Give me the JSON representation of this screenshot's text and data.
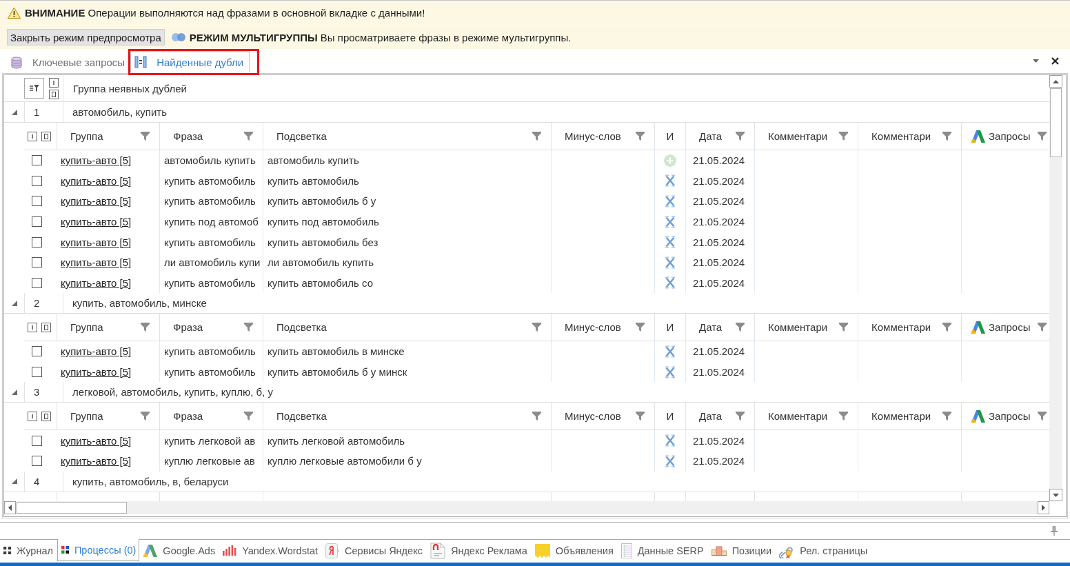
{
  "notice": "**ВНИМАНИЕ** Операции выполняются над фразами в основной вкладке с данными!",
  "preview_bar": {
    "close_button": "Закрыть режим предпросмотра",
    "message": "**РЕЖИМ МУЛЬТИГРУППЫ** Вы просматриваете фразы в режиме мультигруппы."
  },
  "tabs": [
    {
      "label": "Ключевые запросы",
      "selected": false,
      "highlighted": false
    },
    {
      "label": "Найденные дубли",
      "selected": true,
      "highlighted": true
    }
  ],
  "table": {
    "header": "Группа неявных дублей",
    "groups": [
      {
        "number": "1",
        "title": "автомобиль, купить",
        "expanded": true,
        "columns": [
          {
            "label": "Группа",
            "kind": "text",
            "filter": true
          },
          {
            "label": "Фраза",
            "kind": "text",
            "filter": true
          },
          {
            "label": "Подсветка",
            "kind": "text",
            "filter": true
          },
          {
            "label": "Минус-слов",
            "kind": "text",
            "filter": true
          },
          {
            "label": "И",
            "kind": "text",
            "filter": false
          },
          {
            "label": "Дата",
            "kind": "text",
            "filter": true
          },
          {
            "label": "Комментари",
            "kind": "text",
            "filter": true
          },
          {
            "label": "Комментари",
            "kind": "text",
            "filter": true
          },
          {
            "label": "Запросы",
            "kind": "source",
            "filter": true
          }
        ],
        "rows": [
          {
            "checked": false,
            "group": "купить-авто [5]",
            "phrase": "автомобиль купить",
            "highlight": "автомобиль купить",
            "kind": "plus",
            "date": "21.05.2024"
          },
          {
            "checked": false,
            "group": "купить-авто [5]",
            "phrase": "купить автомобиль",
            "highlight": "купить автомобиль",
            "kind": "cross",
            "date": "21.05.2024"
          },
          {
            "checked": false,
            "group": "купить-авто [5]",
            "phrase": "купить автомобиль",
            "highlight": "купить автомобиль б у",
            "kind": "cross",
            "date": "21.05.2024"
          },
          {
            "checked": false,
            "group": "купить-авто [5]",
            "phrase": "купить под автомоб",
            "highlight": "купить под автомобиль",
            "kind": "cross",
            "date": "21.05.2024"
          },
          {
            "checked": false,
            "group": "купить-авто [5]",
            "phrase": "купить автомобиль",
            "highlight": "купить автомобиль без",
            "kind": "cross",
            "date": "21.05.2024"
          },
          {
            "checked": false,
            "group": "купить-авто [5]",
            "phrase": "ли автомобиль купи",
            "highlight": "ли автомобиль купить",
            "kind": "cross",
            "date": "21.05.2024"
          },
          {
            "checked": false,
            "group": "купить-авто [5]",
            "phrase": "купить автомобиль",
            "highlight": "купить автомобиль со",
            "kind": "cross",
            "date": "21.05.2024"
          }
        ]
      },
      {
        "number": "2",
        "title": "купить, автомобиль, минске",
        "expanded": true,
        "columns": [
          {
            "label": "Группа",
            "kind": "text",
            "filter": true
          },
          {
            "label": "Фраза",
            "kind": "text",
            "filter": true
          },
          {
            "label": "Подсветка",
            "kind": "text",
            "filter": true
          },
          {
            "label": "Минус-слов",
            "kind": "text",
            "filter": true
          },
          {
            "label": "И",
            "kind": "text",
            "filter": false
          },
          {
            "label": "Дата",
            "kind": "text",
            "filter": true
          },
          {
            "label": "Комментари",
            "kind": "text",
            "filter": true
          },
          {
            "label": "Комментари",
            "kind": "text",
            "filter": true
          },
          {
            "label": "Запросы",
            "kind": "source",
            "filter": true
          }
        ],
        "rows": [
          {
            "checked": false,
            "group": "купить-авто [5]",
            "phrase": "купить автомобиль",
            "highlight": "купить автомобиль в минске",
            "kind": "cross",
            "date": "21.05.2024"
          },
          {
            "checked": false,
            "group": "купить-авто [5]",
            "phrase": "купить автомобиль",
            "highlight": "купить автомобиль б у минск",
            "kind": "cross",
            "date": "21.05.2024"
          }
        ]
      },
      {
        "number": "3",
        "title": "легковой, автомобиль, купить, куплю, б, у",
        "expanded": true,
        "columns": [
          {
            "label": "Группа",
            "kind": "text",
            "filter": true
          },
          {
            "label": "Фраза",
            "kind": "text",
            "filter": true
          },
          {
            "label": "Подсветка",
            "kind": "text",
            "filter": true
          },
          {
            "label": "Минус-слов",
            "kind": "text",
            "filter": true
          },
          {
            "label": "И",
            "kind": "text",
            "filter": false
          },
          {
            "label": "Дата",
            "kind": "text",
            "filter": true
          },
          {
            "label": "Комментари",
            "kind": "text",
            "filter": true
          },
          {
            "label": "Комментари",
            "kind": "text",
            "filter": true
          },
          {
            "label": "Запросы",
            "kind": "source",
            "filter": true
          }
        ],
        "rows": [
          {
            "checked": false,
            "group": "купить-авто [5]",
            "phrase": "купить легковой ав",
            "highlight": "купить легковой автомобиль",
            "kind": "cross",
            "date": "21.05.2024"
          },
          {
            "checked": false,
            "group": "купить-авто [5]",
            "phrase": "куплю легковые ав",
            "highlight": "куплю легковые автомобили б у",
            "kind": "cross",
            "date": "21.05.2024"
          }
        ]
      },
      {
        "number": "4",
        "title": "купить, автомобиль, в, беларуси",
        "expanded": true
      }
    ]
  },
  "bottom_tabs": [
    {
      "label": "Журнал",
      "selected": false
    },
    {
      "label": "Процессы (0)",
      "selected": true
    },
    {
      "label": "Google.Ads",
      "selected": false
    },
    {
      "label": "Yandex.Wordstat",
      "selected": false
    },
    {
      "label": "Сервисы Яндекс",
      "selected": false
    },
    {
      "label": "Яндекс Реклама",
      "selected": false
    },
    {
      "label": "Объявления",
      "selected": false
    },
    {
      "label": "Данные SERP",
      "selected": false
    },
    {
      "label": "Позиции",
      "selected": false
    },
    {
      "label": "Рел. страницы",
      "selected": false
    }
  ]
}
